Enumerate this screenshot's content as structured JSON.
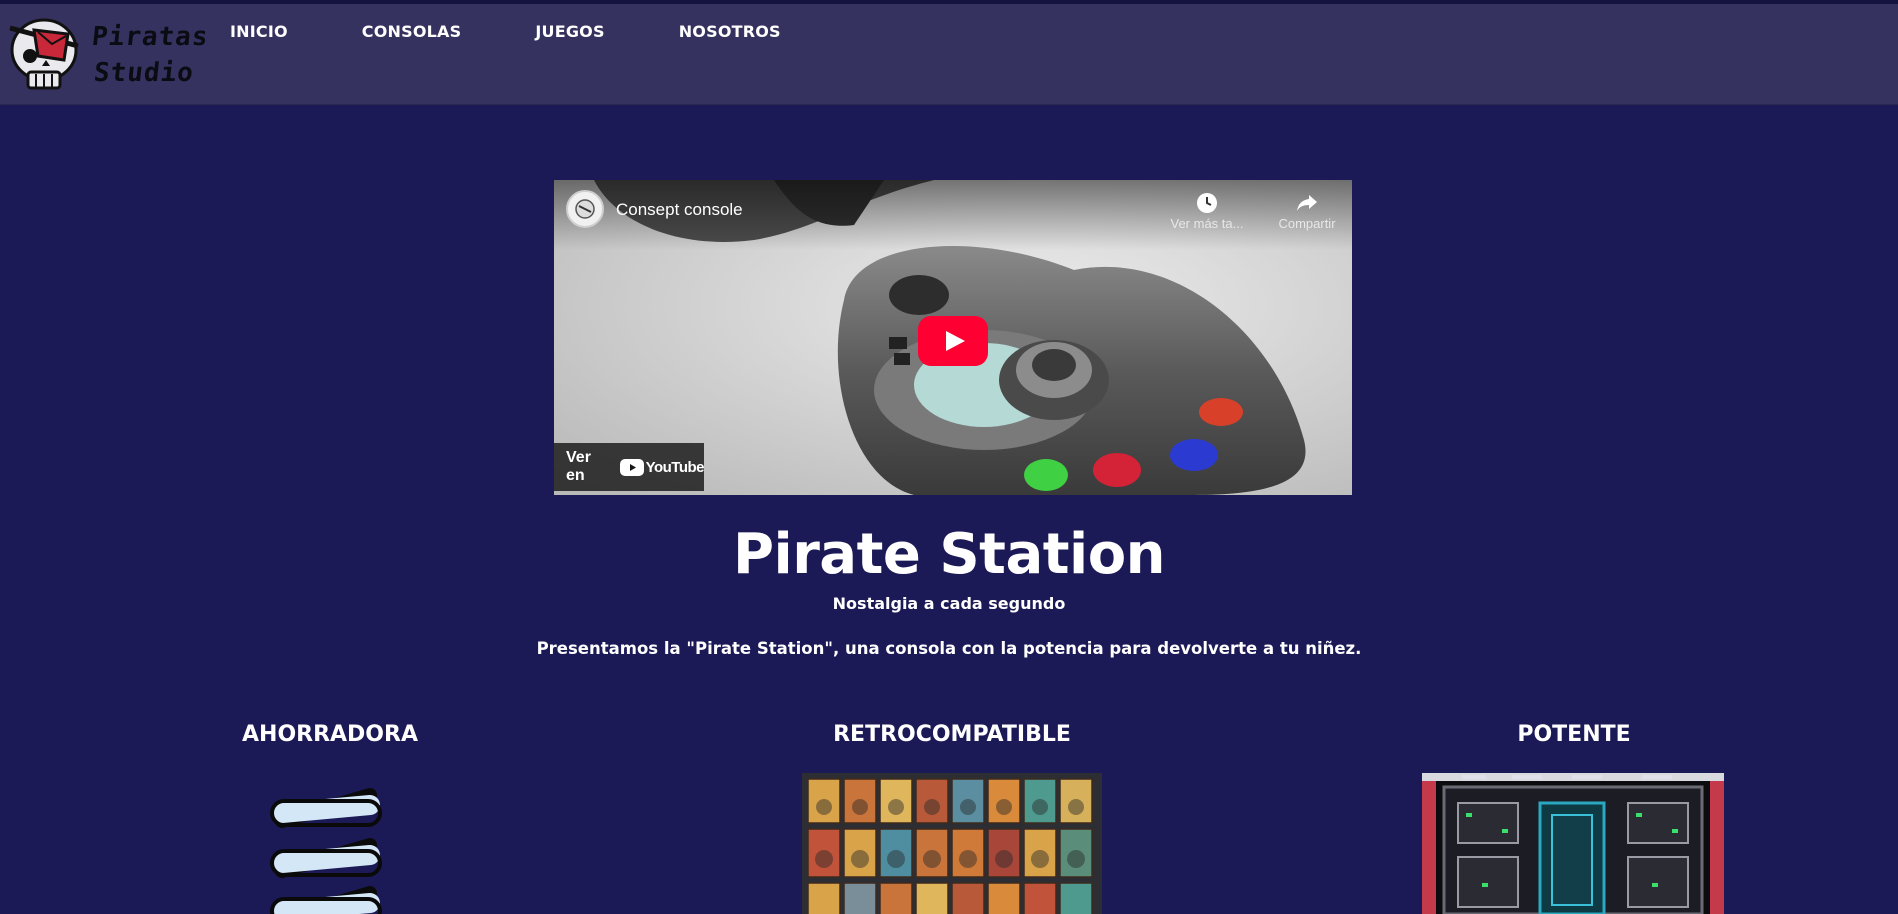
{
  "header": {
    "logo_line1": "Piratas",
    "logo_line2": "Studio",
    "nav": [
      "INICIO",
      "CONSOLAS",
      "JUEGOS",
      "NOSOTROS"
    ]
  },
  "video": {
    "title": "Consept console",
    "watch_later_label": "Ver más ta...",
    "share_label": "Compartir",
    "watch_on_label": "Ver en",
    "youtube_label": "YouTube"
  },
  "hero": {
    "title": "Pirate Station",
    "subtitle": "Nostalgia a cada segundo",
    "intro": "Presentamos la \"Pirate Station\", una consola con la potencia para devolverte a tu niñez."
  },
  "features": [
    "AHORRADORA",
    "RETROCOMPATIBLE",
    "POTENTE"
  ],
  "colors": {
    "page_bg": "#1c1a56",
    "header_bg": "#35325f",
    "youtube_red": "#ff0033"
  },
  "icons": [
    "skull-logo-icon",
    "clock-icon",
    "share-arrow-icon",
    "play-icon",
    "youtube-icon"
  ]
}
